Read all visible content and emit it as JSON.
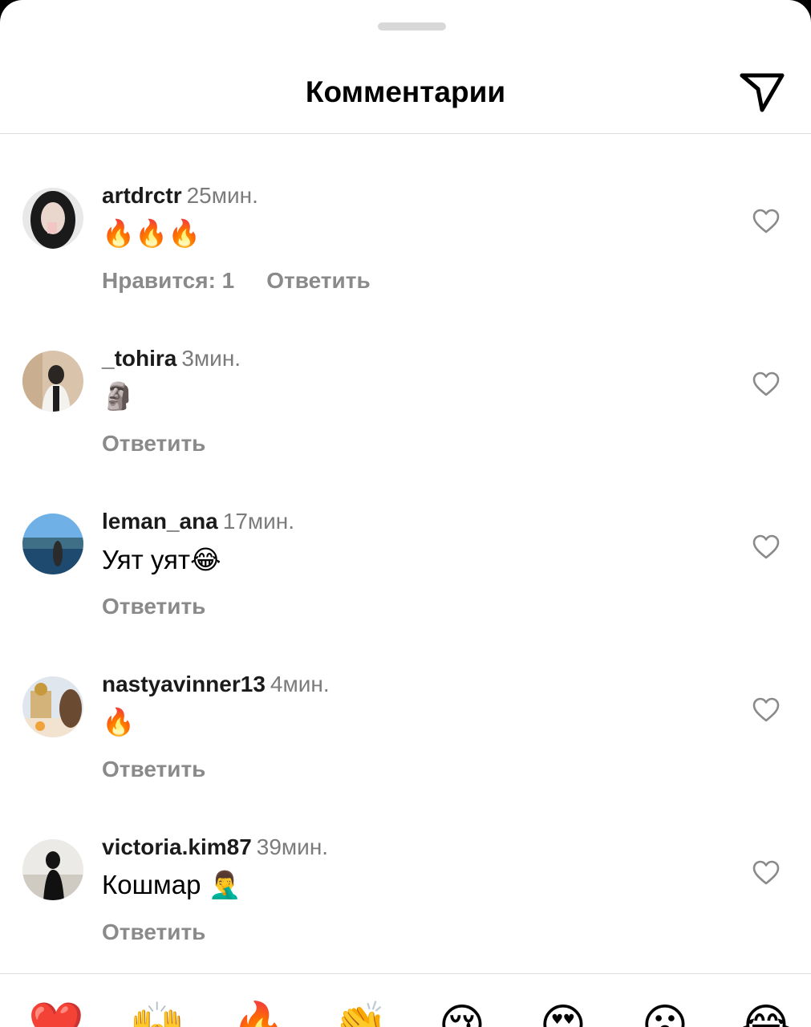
{
  "header": {
    "title": "Комментарии",
    "send_icon": "paper-plane-icon"
  },
  "comments": [
    {
      "username": "artdrctr",
      "time": "25мин.",
      "text": "🔥🔥🔥",
      "likes": "Нравится: 1",
      "reply": "Ответить"
    },
    {
      "username": "_tohira",
      "time": "3мин.",
      "text": "🗿",
      "reply": "Ответить"
    },
    {
      "username": "leman_ana",
      "time": "17мин.",
      "text": "Уят уят😂",
      "reply": "Ответить"
    },
    {
      "username": "nastyavinner13",
      "time": "4мин.",
      "text": "🔥",
      "reply": "Ответить"
    },
    {
      "username": "victoria.kim87",
      "time": "39мин.",
      "text": "Кошмар 🤦‍♂️",
      "reply": "Ответить"
    }
  ],
  "reactions": [
    "❤️",
    "🙌",
    "🔥",
    "👏",
    "😢",
    "😍",
    "😮",
    "😂"
  ],
  "colors": {
    "background": "#ffffff",
    "username": "#1b1b1b",
    "meta": "#7b7b7b",
    "divider": "#dcdcdc"
  }
}
